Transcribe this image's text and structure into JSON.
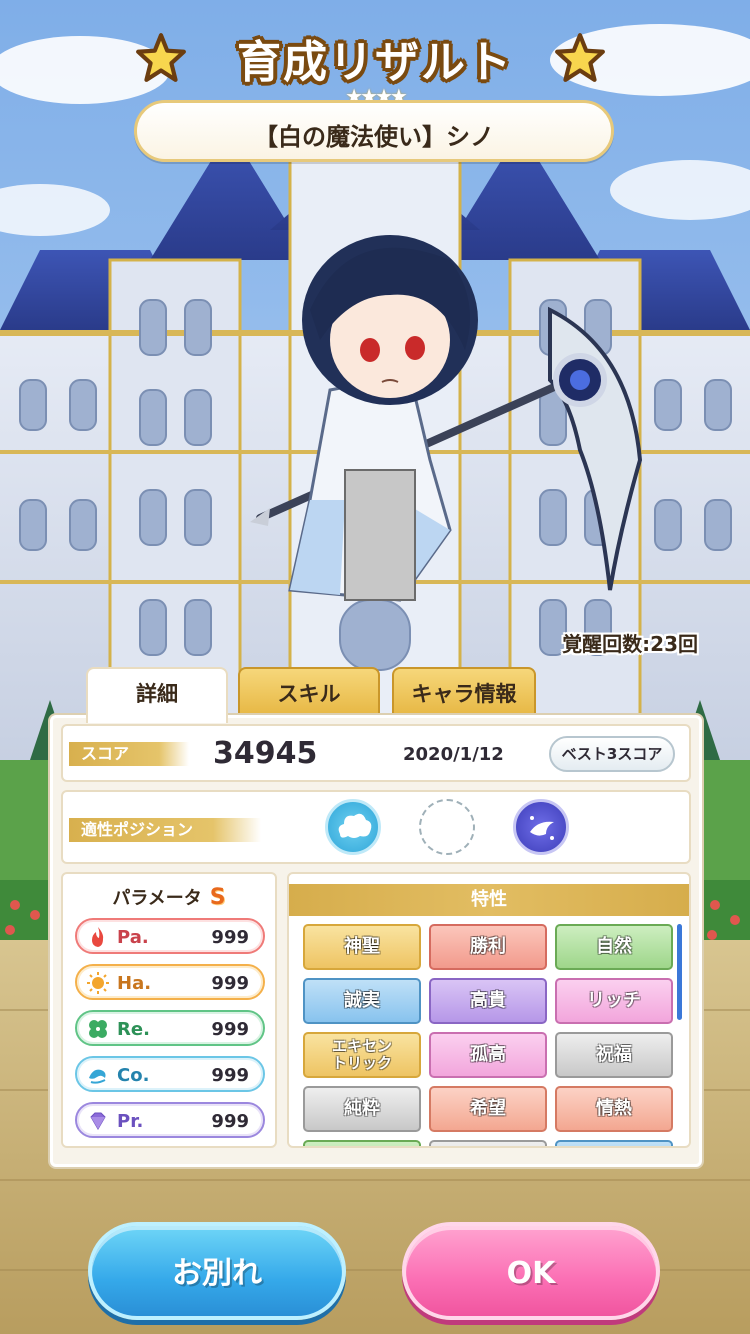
{
  "header": {
    "title": "育成リザルト",
    "rarity_stars": "★★★★",
    "character_name": "【白の魔法使い】シノ"
  },
  "awakening_text": "覚醒回数:23回",
  "tabs": [
    {
      "label": "詳細",
      "active": true
    },
    {
      "label": "スキル",
      "active": false
    },
    {
      "label": "キャラ情報",
      "active": false
    }
  ],
  "score": {
    "label": "スコア",
    "value": "34945",
    "date": "2020/1/12",
    "best_button": "ベスト3スコア"
  },
  "position": {
    "label": "適性ポジション",
    "icons": [
      "cloud-position-icon",
      "empty-position-slot",
      "night-position-icon"
    ]
  },
  "parameters": {
    "label": "パラメータ",
    "grade": "S",
    "stats": [
      {
        "key": "Pa.",
        "value": "999",
        "icon": "flame-icon",
        "color": "#c9424b"
      },
      {
        "key": "Ha.",
        "value": "999",
        "icon": "sun-icon",
        "color": "#c8761e"
      },
      {
        "key": "Re.",
        "value": "999",
        "icon": "clover-icon",
        "color": "#2d9157"
      },
      {
        "key": "Co.",
        "value": "999",
        "icon": "wave-icon",
        "color": "#2483ad"
      },
      {
        "key": "Pr.",
        "value": "999",
        "icon": "diamond-icon",
        "color": "#6b51bf"
      }
    ]
  },
  "traits": {
    "label": "特性",
    "items": [
      {
        "label": "神聖",
        "style": "gold"
      },
      {
        "label": "勝利",
        "style": "red"
      },
      {
        "label": "自然",
        "style": "green"
      },
      {
        "label": "誠実",
        "style": "blue"
      },
      {
        "label": "高貴",
        "style": "purple"
      },
      {
        "label": "リッチ",
        "style": "pink"
      },
      {
        "label": "エキセン\nトリック",
        "style": "gold"
      },
      {
        "label": "孤高",
        "style": "pink"
      },
      {
        "label": "祝福",
        "style": "silver"
      },
      {
        "label": "純粋",
        "style": "silver"
      },
      {
        "label": "希望",
        "style": "salmon"
      },
      {
        "label": "情熱",
        "style": "salmon"
      }
    ]
  },
  "buttons": {
    "farewell": "お別れ",
    "ok": "OK"
  }
}
